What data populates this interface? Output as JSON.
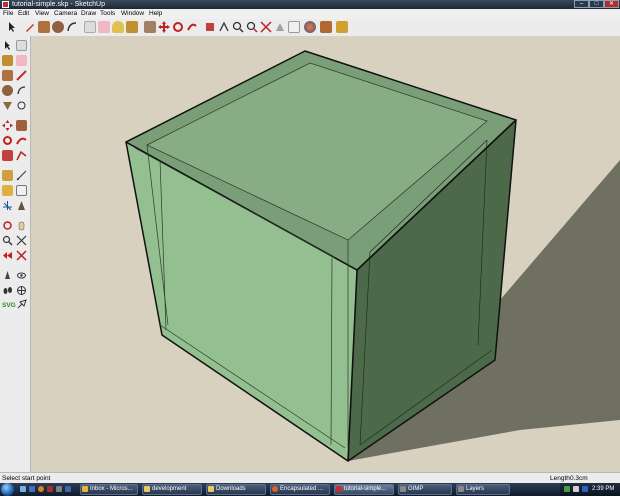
{
  "window": {
    "title": "tutorial-simple.skp - SketchUp"
  },
  "menu": [
    "File",
    "Edit",
    "View",
    "Camera",
    "Draw",
    "Tools",
    "Window",
    "Help"
  ],
  "palette": {
    "svg_label": "SVG"
  },
  "status": {
    "prompt": "Select start point",
    "measurement_label": "Length",
    "measurement_value": "0.3cm"
  },
  "taskbar": {
    "tasks": [
      {
        "label": "Inbox - Micros...",
        "color": "#e6b830"
      },
      {
        "label": "development",
        "color": "#e8c860"
      },
      {
        "label": "Downloads",
        "color": "#e8c860"
      },
      {
        "label": "Encapsulated ...",
        "color": "#e06020"
      },
      {
        "label": "tutorial-simple...",
        "color": "#c03030"
      },
      {
        "label": "GIMP",
        "color": "#888888"
      },
      {
        "label": "Layers",
        "color": "#888888"
      }
    ],
    "clock": "2:39 PM"
  },
  "colors": {
    "cube_top": "#7a9e77",
    "cube_front": "#94bf91",
    "cube_right": "#4c6a4a",
    "shadow": "#707062",
    "background": "#d8d1c0"
  }
}
